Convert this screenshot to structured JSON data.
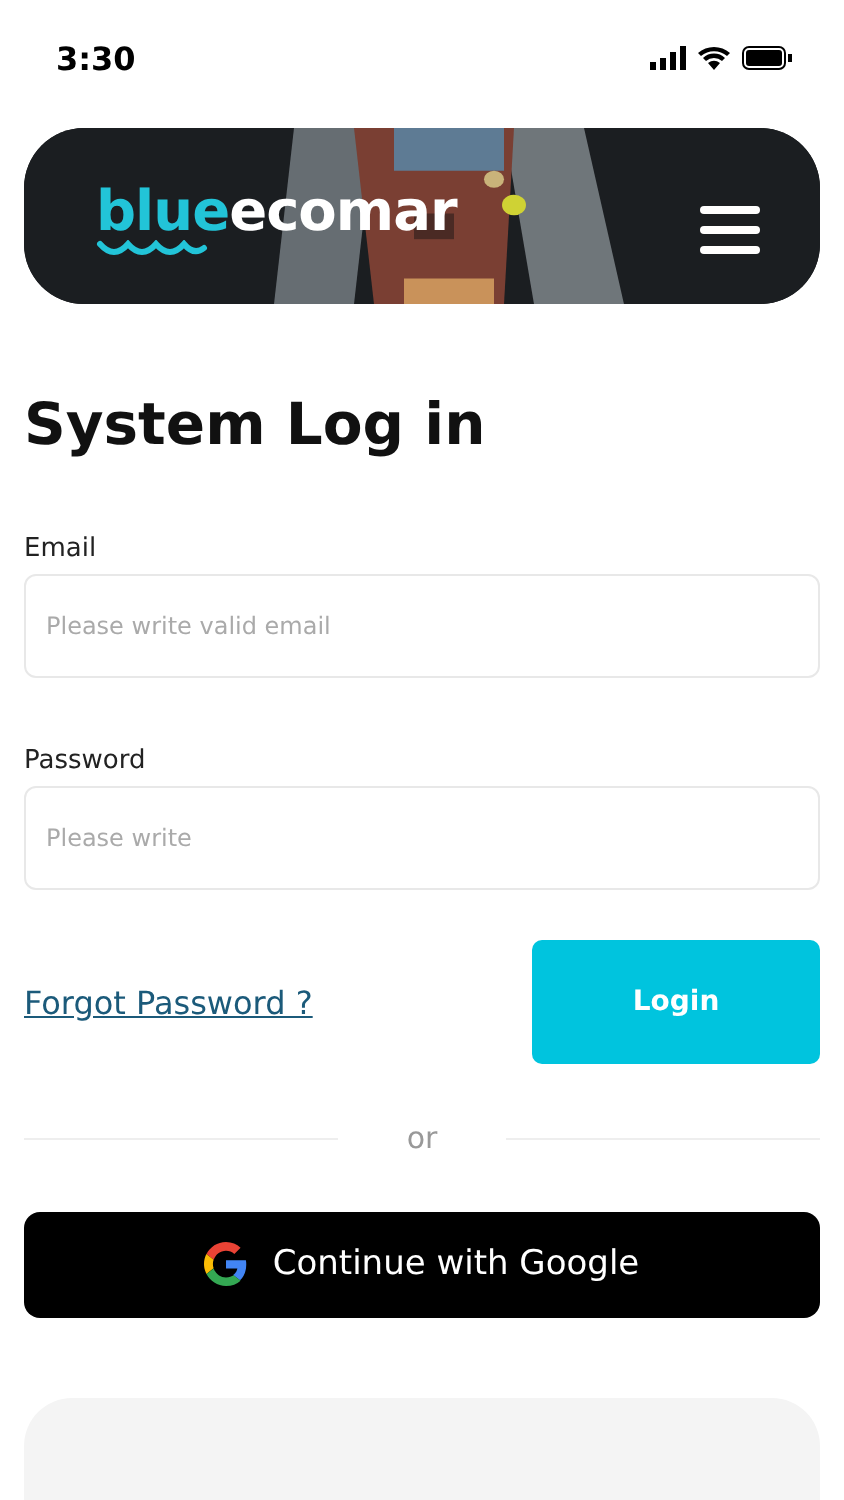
{
  "status_bar": {
    "time": "3:30"
  },
  "header": {
    "logo": {
      "part_1": "blue",
      "part_2": "ecomar"
    }
  },
  "title": "System Log in",
  "fields": [
    {
      "label": "Email",
      "placeholder": "Please write valid email"
    },
    {
      "label": "Password",
      "placeholder": "Please write"
    }
  ],
  "forgot_link": "Forgot Password ?",
  "login_button": "Login",
  "divider_text": "or",
  "google_button": "Continue with Google"
}
